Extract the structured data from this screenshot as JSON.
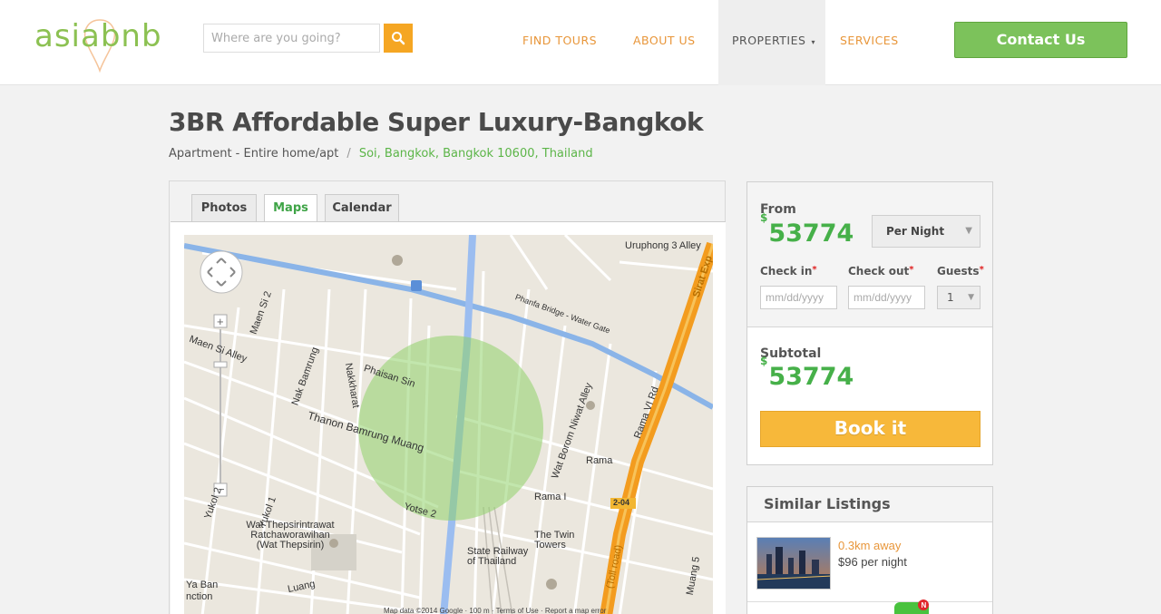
{
  "header": {
    "logo_text": "asiabnb",
    "search_placeholder": "Where are you going?",
    "nav": [
      {
        "label": "FIND TOURS"
      },
      {
        "label": "ABOUT US"
      },
      {
        "label": "PROPERTIES",
        "caret": "▾"
      },
      {
        "label": "SERVICES"
      }
    ],
    "contact_label": "Contact Us"
  },
  "listing": {
    "title": "3BR Affordable Super Luxury-Bangkok",
    "type": "Apartment - Entire home/apt",
    "separator": "/",
    "location": "Soi, Bangkok, Bangkok 10600, Thailand"
  },
  "tabs": [
    {
      "label": "Photos",
      "active": false
    },
    {
      "label": "Maps",
      "active": true
    },
    {
      "label": "Calendar",
      "active": false
    }
  ],
  "map": {
    "labels": [
      "Uruphong 3 Alley",
      "Phanfa Bridge - Water Gate",
      "Phaisan Sin",
      "Thanon Bamrung Muang",
      "Nakkharat",
      "Nak Bamrung",
      "Maen Si 2",
      "Maen Si Alley",
      "Wat Borom Niwat Alley",
      "Rama VI Rd",
      "Rama I",
      "Rama",
      "Yotse 2",
      "Wat Thepsirintrawat Ratchaworawihan (Wat Thepsirin)",
      "State Railway of Thailand",
      "The Twin Towers",
      "Luang",
      "Ya Ban",
      "nction",
      "Sirat Exp",
      "Yukol 2",
      "Yukol 1",
      "2-04",
      "(Toll road)",
      "Muang 5"
    ],
    "footer": "Map data ©2014 Google · 100 m · Terms of Use · Report a map error"
  },
  "booking": {
    "from_label": "From",
    "currency": "$",
    "price": "53774",
    "period": "Per Night",
    "checkin_label": "Check in",
    "checkout_label": "Check out",
    "guests_label": "Guests",
    "required_mark": "*",
    "date_placeholder": "mm/dd/yyyy",
    "guests_value": "1",
    "subtotal_label": "Subtotal",
    "subtotal": "53774",
    "book_label": "Book it"
  },
  "similar": {
    "title": "Similar Listings",
    "items": [
      {
        "distance": "0.3km away",
        "price": "$96 per night"
      }
    ]
  },
  "chat": {
    "badge": "N"
  },
  "colors": {
    "brand_green": "#8cc152",
    "nav_orange": "#e8963a",
    "price_green": "#46b049",
    "book_orange": "#f7b83a",
    "contact_green": "#7cc25b"
  }
}
